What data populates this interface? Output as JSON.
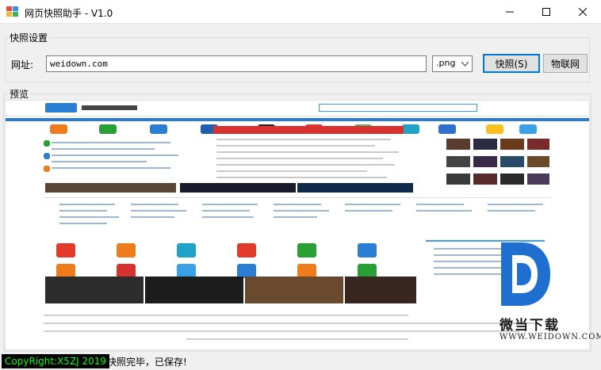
{
  "window": {
    "title": "网页快照助手 - V1.0"
  },
  "settings_group": {
    "title": "快照设置",
    "url_label": "网址:",
    "url_value": "weidown.com",
    "format_value": ".png",
    "snapshot_button": "快照(S)",
    "iot_button": "物联网"
  },
  "preview_group": {
    "title": "预览"
  },
  "statusbar": {
    "copyright": "CopyRight:X5ZJ 2019",
    "message": "快照完毕，已保存!"
  },
  "watermark": {
    "name": "微当下载",
    "url": "WWW.WEIDOWN.COM"
  },
  "colors": {
    "accent_blue": "#0078d7",
    "copyright_bg": "#000000",
    "copyright_fg": "#00ff00",
    "watermark_blue": "#1f6fd1"
  }
}
